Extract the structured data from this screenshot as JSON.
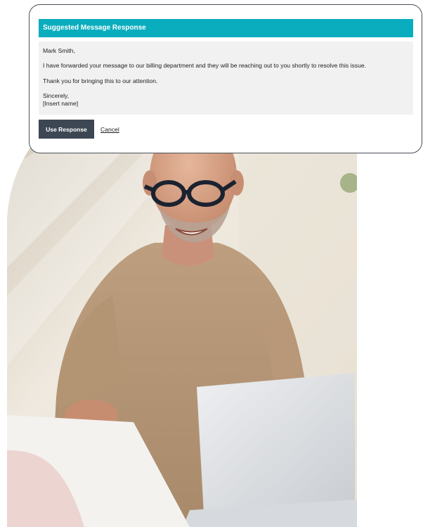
{
  "card": {
    "title": "Suggested Message Response",
    "greeting": "Mark Smith,",
    "message": "I have forwarded your message to our billing department and they will be reaching out to you shortly to resolve this issue.",
    "thanks": "Thank you for bringing this to our attention.",
    "signoff": "Sincerely,",
    "signature": "[Insert name]",
    "use_button_label": "Use Response",
    "cancel_label": "Cancel"
  },
  "colors": {
    "header": "#0aadbe",
    "button": "#3d4754",
    "body_bg": "#f1f1f1",
    "card_border": "#4a4f57"
  }
}
